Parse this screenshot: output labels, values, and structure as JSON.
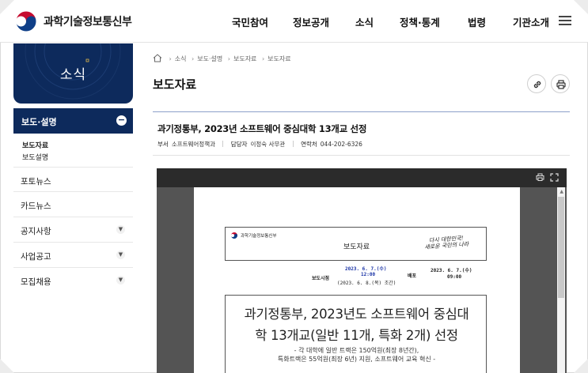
{
  "header": {
    "site_name": "과학기술정보통신부",
    "nav": [
      "국민참여",
      "정보공개",
      "소식",
      "정책·통계",
      "법령",
      "기관소개"
    ]
  },
  "sidebar": {
    "banner_title": "소식",
    "active_section": "보도·설명",
    "active_toggle": "−",
    "sub_items": [
      "보도자료",
      "보도설명"
    ],
    "items": [
      {
        "label": "포토뉴스",
        "has_toggle": false
      },
      {
        "label": "카드뉴스",
        "has_toggle": false
      },
      {
        "label": "공지사항",
        "has_toggle": true
      },
      {
        "label": "사업공고",
        "has_toggle": true
      },
      {
        "label": "모집채용",
        "has_toggle": true
      }
    ],
    "toggle_glyph": "⊕"
  },
  "breadcrumb": [
    "소식",
    "보도·설명",
    "보도자료",
    "보도자료"
  ],
  "page_title": "보도자료",
  "article": {
    "title": "과기정통부, 2023년 소프트웨어 중심대학 13개교 선정",
    "dept_label": "부서",
    "dept_value": "소프트웨어정책과",
    "manager_label": "담당자",
    "manager_value": "이정숙 사무관",
    "contact_label": "연락처",
    "contact_value": "044-202-6326"
  },
  "document": {
    "logo_text": "과학기술정보통신부",
    "doc_type": "보도자료",
    "slogan_line1": "다시 대한민국!",
    "slogan_line2": "새로운 국민의 나라",
    "embargo_label": "보도시점",
    "embargo_date": "2023. 6. 7.(수)",
    "embargo_time": "12:00",
    "embargo_note": "(2023. 6. 8.(목) 조간)",
    "dist_label": "배포",
    "dist_date": "2023. 6. 7.(수)",
    "dist_time": "09:00",
    "headline_line1": "과기정통부, 2023년도 소프트웨어 중심대",
    "headline_line2": "학 13개교(일반 11개, 특화 2개) 선정",
    "summary_line1": "- 각 대학에   일반 트랙은 150억원(최장 8년간),",
    "summary_line2": "특화트랙은 55억원(최장 6년) 지원, 소프트웨어 교육 혁신 -"
  },
  "colors": {
    "navy": "#0d2a5c",
    "rule": "#8da0c9",
    "blue_text": "#1a33a6"
  }
}
